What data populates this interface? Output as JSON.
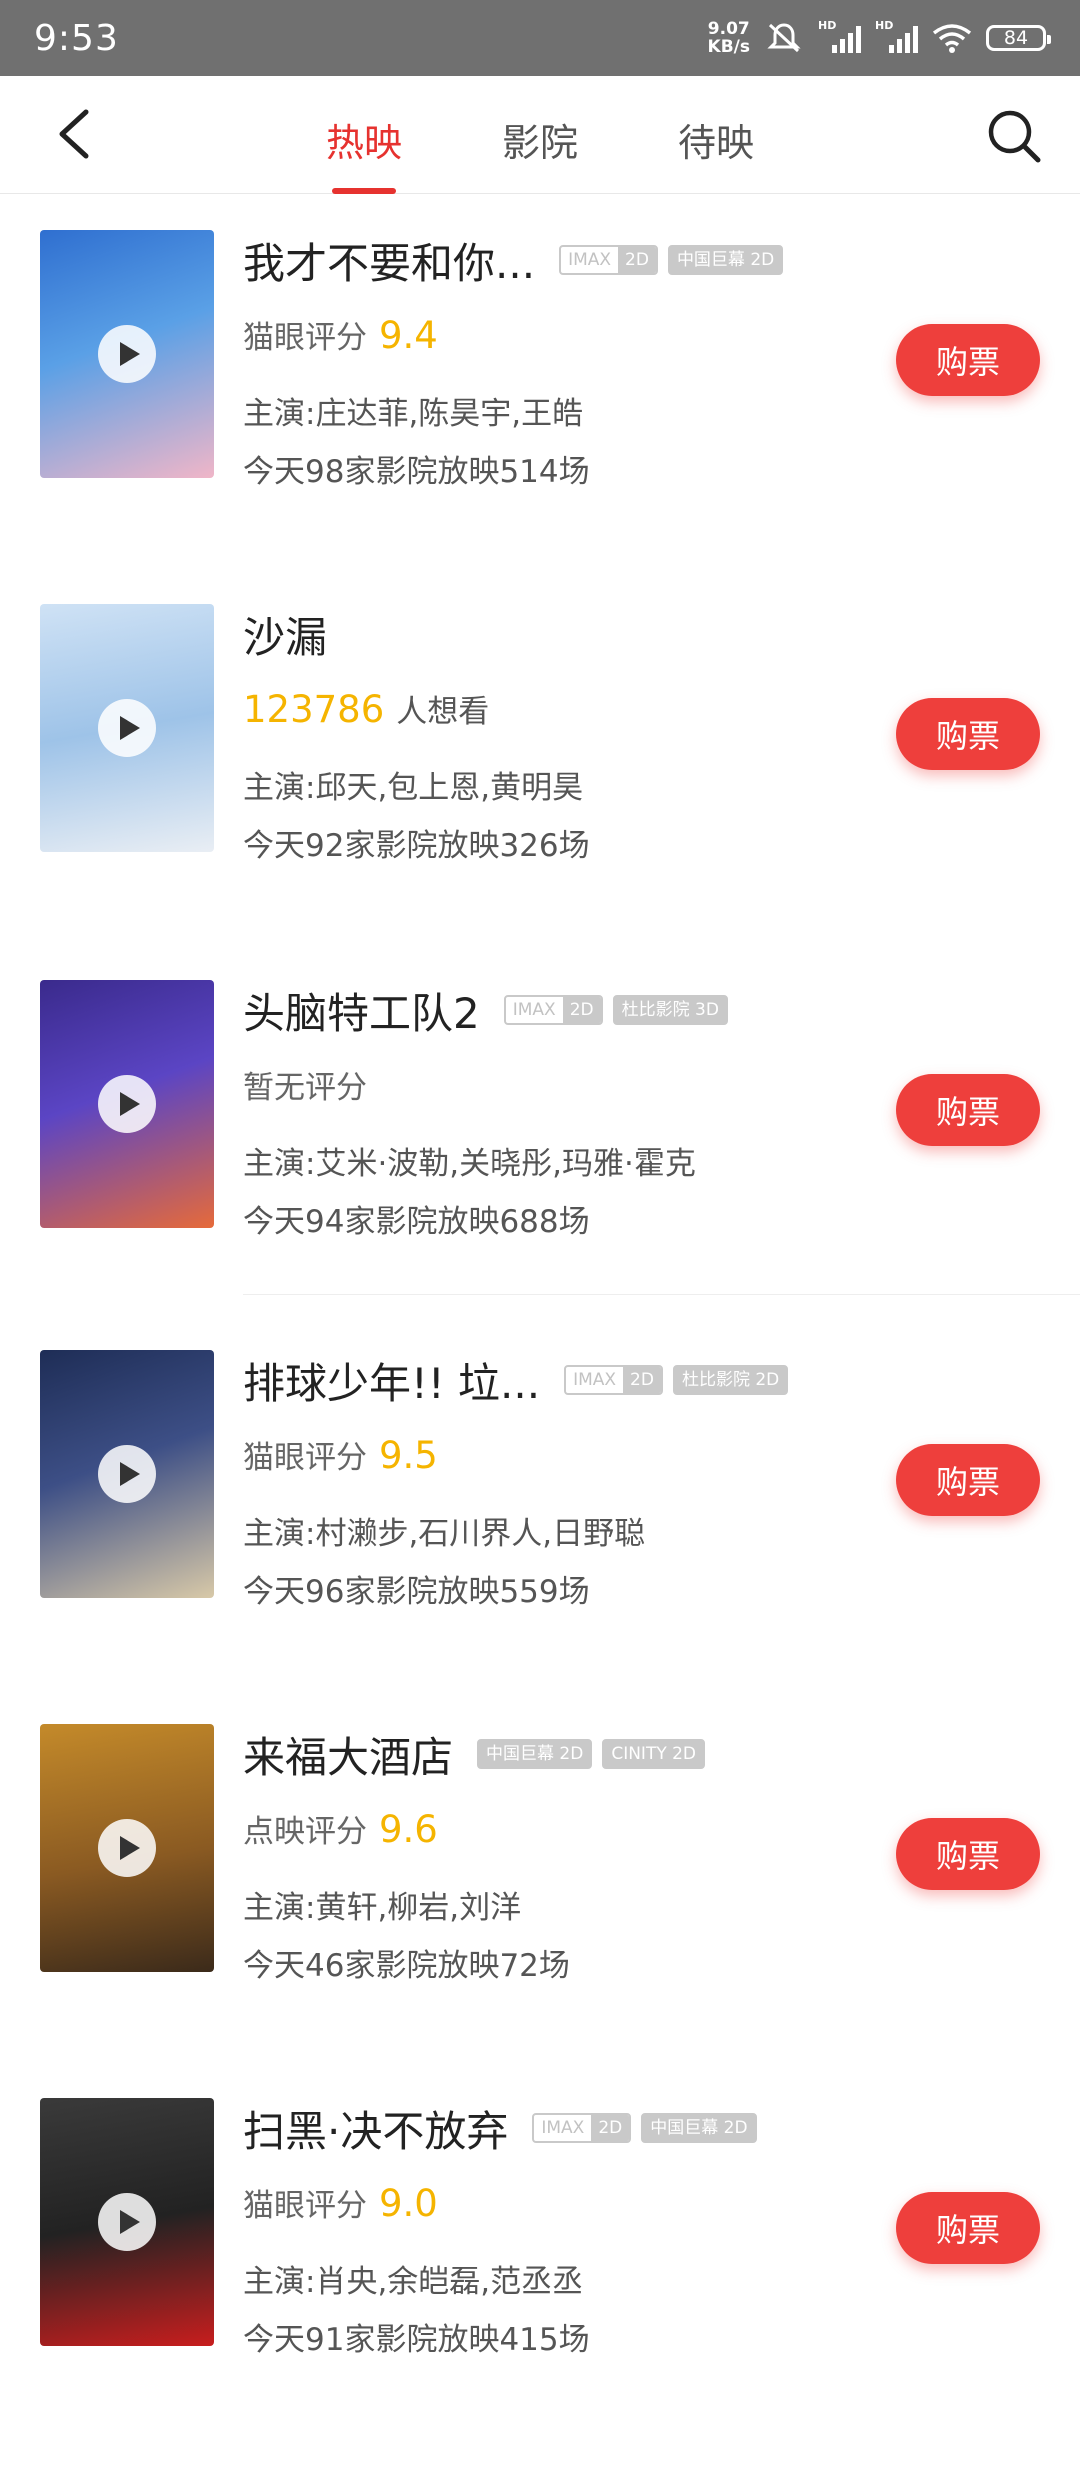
{
  "status_bar": {
    "time": "9:53",
    "net_speed_value": "9.07",
    "net_speed_unit": "KB/s",
    "hd1": "HD",
    "hd2": "HD",
    "battery": "84"
  },
  "nav": {
    "tabs": [
      {
        "label": "热映",
        "active": true
      },
      {
        "label": "影院",
        "active": false
      },
      {
        "label": "待映",
        "active": false
      }
    ]
  },
  "buy_label": "购票",
  "movies": [
    {
      "title": "我才不要和你...",
      "tags": [
        [
          "IMAX",
          "2D"
        ],
        [
          "中国巨幕 2D"
        ]
      ],
      "score_label": "猫眼评分",
      "score": "9.4",
      "actors": "主演:庄达菲,陈昊宇,王皓",
      "showings": "今天98家影院放映514场",
      "poster_colors": [
        "#2f6fd0",
        "#f0b6c8"
      ]
    },
    {
      "title": "沙漏",
      "tags": [],
      "wants_num": "123786",
      "wants_txt": "人想看",
      "actors": "主演:邱天,包上恩,黄明昊",
      "showings": "今天92家影院放映326场",
      "poster_colors": [
        "#b7d3ee",
        "#e9eef4"
      ]
    },
    {
      "title": "头脑特工队2",
      "tags": [
        [
          "IMAX",
          "2D"
        ],
        [
          "杜比影院 3D"
        ]
      ],
      "score_label": "暂无评分",
      "score": "",
      "actors": "主演:艾米·波勒,关晓彤,玛雅·霍克",
      "showings": "今天94家影院放映688场",
      "poster_colors": [
        "#3a2a8c",
        "#e66a3a"
      ]
    },
    {
      "title": "排球少年!! 垃...",
      "tags": [
        [
          "IMAX",
          "2D"
        ],
        [
          "杜比影院 2D"
        ]
      ],
      "score_label": "猫眼评分",
      "score": "9.5",
      "actors": "主演:村濑步,石川界人,日野聪",
      "showings": "今天96家影院放映559场",
      "poster_colors": [
        "#1e2d56",
        "#d8c9a8"
      ]
    },
    {
      "title": "来福大酒店",
      "tags": [
        [
          "中国巨幕 2D"
        ],
        [
          "CINITY 2D"
        ]
      ],
      "score_label": "点映评分",
      "score": "9.6",
      "actors": "主演:黄轩,柳岩,刘洋",
      "showings": "今天46家影院放映72场",
      "poster_colors": [
        "#c48a2a",
        "#3b2a1a"
      ]
    },
    {
      "title": "扫黑·决不放弃",
      "tags": [
        [
          "IMAX",
          "2D"
        ],
        [
          "中国巨幕 2D"
        ]
      ],
      "score_label": "猫眼评分",
      "score": "9.0",
      "actors": "主演:肖央,余皑磊,范丞丞",
      "showings": "今天91家影院放映415场",
      "poster_colors": [
        "#222222",
        "#c81e1e"
      ]
    }
  ]
}
